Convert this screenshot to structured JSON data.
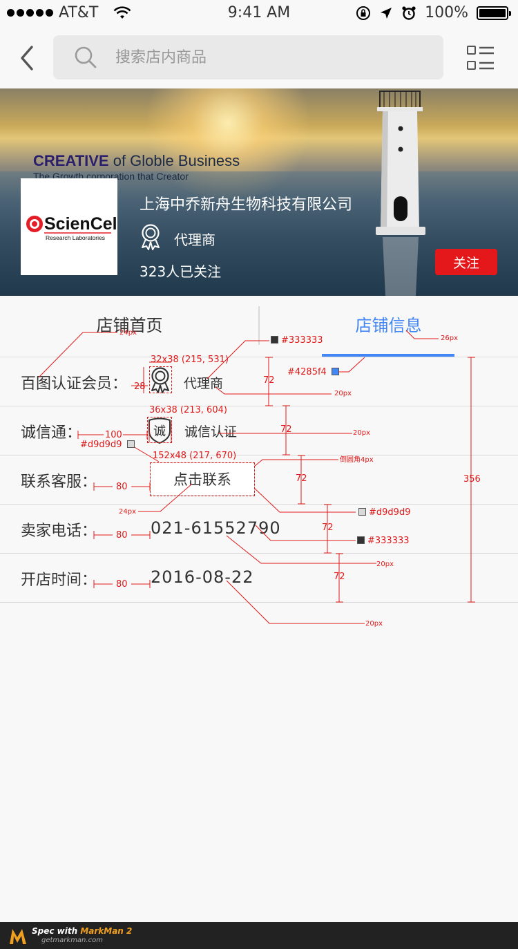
{
  "status_bar": {
    "carrier": "AT&T",
    "time": "9:41 AM",
    "battery": "100%"
  },
  "nav": {
    "search_placeholder": "搜索店内商品",
    "icons": [
      "back-chevron-icon",
      "search-icon",
      "menu-grid-icon"
    ]
  },
  "banner": {
    "tagline_bold": "CREATIVE",
    "tagline_rest": " of Globle Business",
    "tagline_sub": "The Growth corporation that Creator",
    "logo_text": "ScienCell",
    "logo_sub": "Research Laboratories",
    "shop_name": "上海中乔新舟生物科技有限公司",
    "badge_text": "代理商",
    "followers": "323人已关注",
    "follow_label": "关注",
    "colors": {
      "follow": "#e4171b"
    }
  },
  "tabs": [
    {
      "label": "店铺首页",
      "active": false
    },
    {
      "label": "店铺信息",
      "active": true
    }
  ],
  "info": {
    "member_label": "百图认证会员：",
    "member_value": "代理商",
    "credit_label": "诚信通：",
    "credit_icon_char": "诚",
    "credit_value": "诚信认证",
    "service_label": "联系客服：",
    "service_button": "点击联系",
    "phone_label": "卖家电话：",
    "phone_value": "021-61552790",
    "open_label": "开店时间：",
    "open_value": "2016-08-22"
  },
  "annotations": {
    "a_24px_tab": "24px",
    "a_333_tab": "#333333",
    "a_26px": "26px",
    "a_icon1": "32x38 (215, 531)",
    "a_28": "28",
    "a_72_1": "72",
    "a_4285": "#4285f4",
    "a_20px_1": "20px",
    "a_icon2": "36x38 (213, 604)",
    "a_100": "100",
    "a_72_2": "72",
    "a_20px_2": "20px",
    "a_d9_1": "#d9d9d9",
    "a_btn": "152x48 (217, 670)",
    "a_radius": "倒圆角4px",
    "a_80_1": "80",
    "a_72_3": "72",
    "a_356": "356",
    "a_24px_btn": "24px",
    "a_d9_2": "#d9d9d9",
    "a_80_2": "80",
    "a_72_4": "72",
    "a_333_row": "#333333",
    "a_20px_3": "20px",
    "a_80_3": "80",
    "a_72_5": "72",
    "a_20px_4": "20px",
    "colors": {
      "annotation": "#e01818",
      "text": "#333333",
      "accent": "#4285f4",
      "divider": "#d9d9d9"
    }
  },
  "footer": {
    "brand_prefix": "Spec with ",
    "brand_name": "MarkMan 2",
    "url": "getmarkman.com"
  }
}
